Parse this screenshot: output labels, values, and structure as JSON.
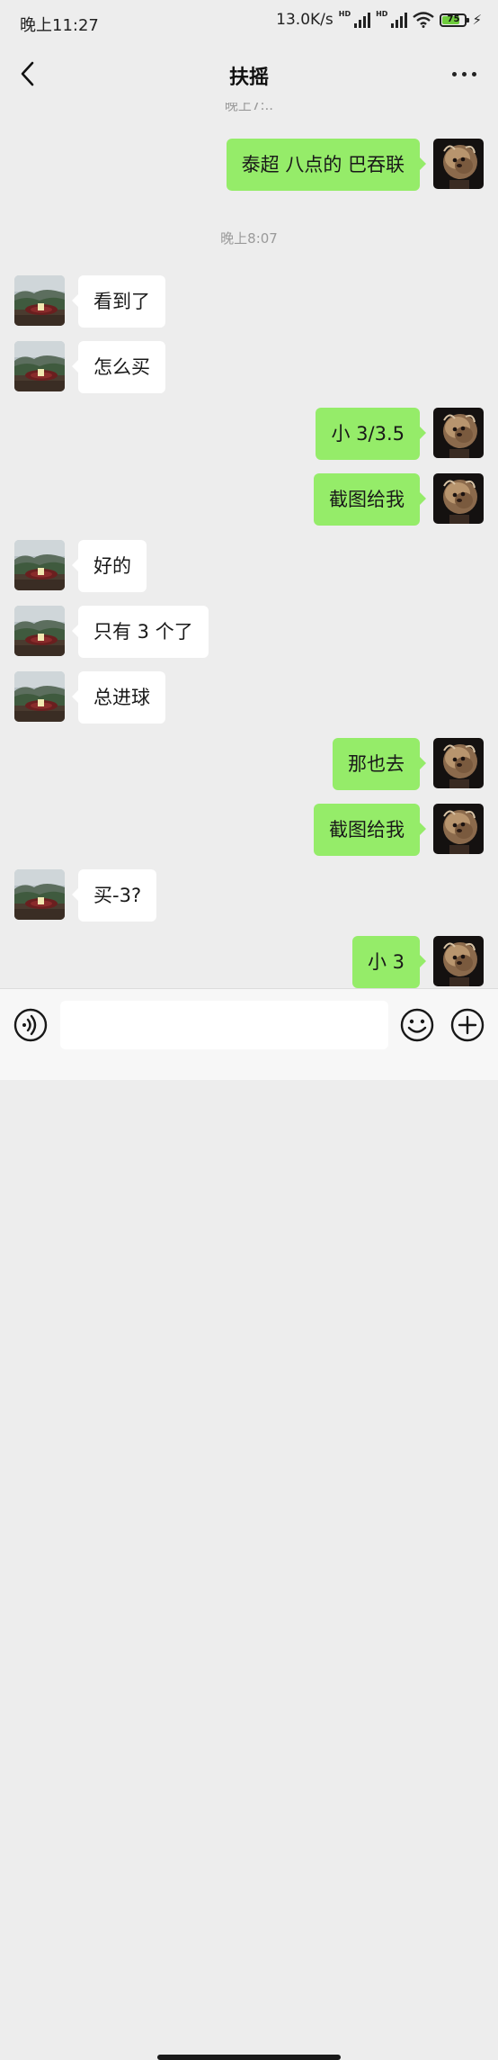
{
  "status_bar": {
    "time": "晚上11:27",
    "network_speed": "13.0K/s",
    "signal_1_label": "HD",
    "signal_2_label": "HD",
    "battery": "75",
    "icons": [
      "signal-icon",
      "signal-icon",
      "wifi-icon",
      "battery-icon",
      "charging-icon"
    ]
  },
  "nav": {
    "back_icon": "chevron-left-icon",
    "title": "扶摇",
    "more_icon": "more-dots-icon"
  },
  "chat": {
    "cut_timestamp": "晚上7:..",
    "messages": [
      {
        "side": "right",
        "text": "泰超 八点的 巴吞联"
      },
      {
        "side": "time",
        "text": "晚上8:07"
      },
      {
        "side": "left",
        "text": "看到了"
      },
      {
        "side": "left",
        "text": "怎么买"
      },
      {
        "side": "right",
        "text": "小 3/3.5"
      },
      {
        "side": "right",
        "text": "截图给我"
      },
      {
        "side": "left",
        "text": "好的"
      },
      {
        "side": "left",
        "text": "只有 3 个了"
      },
      {
        "side": "left",
        "text": "总进球"
      },
      {
        "side": "right",
        "text": "那也去"
      },
      {
        "side": "right",
        "text": "截图给我"
      },
      {
        "side": "left",
        "text": "买-3?"
      },
      {
        "side": "right",
        "text": "小 3"
      }
    ]
  },
  "input_bar": {
    "voice_icon": "voice-icon",
    "input_value": "",
    "input_placeholder": "",
    "emoji_icon": "emoji-icon",
    "plus_icon": "plus-icon"
  },
  "colors": {
    "background": "#ededed",
    "sent_bubble": "#95ec69",
    "received_bubble": "#ffffff",
    "timestamp_text": "#9a9a9a"
  }
}
